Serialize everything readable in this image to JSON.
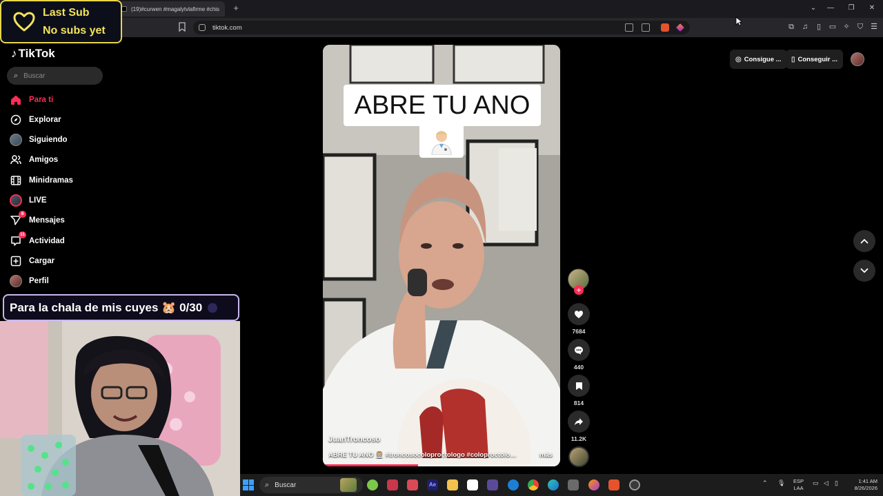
{
  "browser": {
    "tab_title": "(19)#curwen #magalytvlafirme #chis",
    "new_tab": "+",
    "url": "tiktok.com",
    "window_controls": [
      "⌄",
      "—",
      "❐",
      "✕"
    ]
  },
  "tiktok": {
    "logo_text": "TikTok",
    "search_placeholder": "Buscar",
    "nav": [
      {
        "label": "Para ti",
        "icon": "home-icon",
        "active": true
      },
      {
        "label": "Explorar",
        "icon": "compass-icon"
      },
      {
        "label": "Siguiendo",
        "icon": "avatar-icon"
      },
      {
        "label": "Amigos",
        "icon": "friends-icon"
      },
      {
        "label": "Minidramas",
        "icon": "film-icon"
      },
      {
        "label": "LIVE",
        "icon": "live-icon"
      },
      {
        "label": "Mensajes",
        "icon": "send-icon",
        "badge": "8"
      },
      {
        "label": "Actividad",
        "icon": "inbox-icon",
        "badge": "11"
      },
      {
        "label": "Cargar",
        "icon": "upload-icon"
      },
      {
        "label": "Perfil",
        "icon": "profile-icon"
      }
    ],
    "top_right": {
      "get_coins": "Consigue ...",
      "get_app": "Conseguir ..."
    },
    "video": {
      "caption": "ABRE TU ANO",
      "author": "JuanTroncoso",
      "description": "ABRE TU ANO 👨🏼‍⚕️ #troncosocoloproctologo #coloproctologia ...",
      "more": "más",
      "progress": 0.4
    },
    "actions": {
      "likes": "7684",
      "comments": "440",
      "saves": "814",
      "shares": "11.2K"
    }
  },
  "stream": {
    "last_sub_title": "Last Sub",
    "last_sub_value": "No subs yet",
    "goal_text": "Para la chala de mis cuyes 🐹 0/30"
  },
  "taskbar": {
    "search_placeholder": "Buscar",
    "lang_top": "ESP",
    "lang_bottom": "LAA",
    "time": "1:41 AM",
    "date": "8/26/2026"
  },
  "colors": {
    "accent": "#fe2c55",
    "overlay_yellow": "#f3e35a",
    "overlay_border": "#e8d74a"
  }
}
